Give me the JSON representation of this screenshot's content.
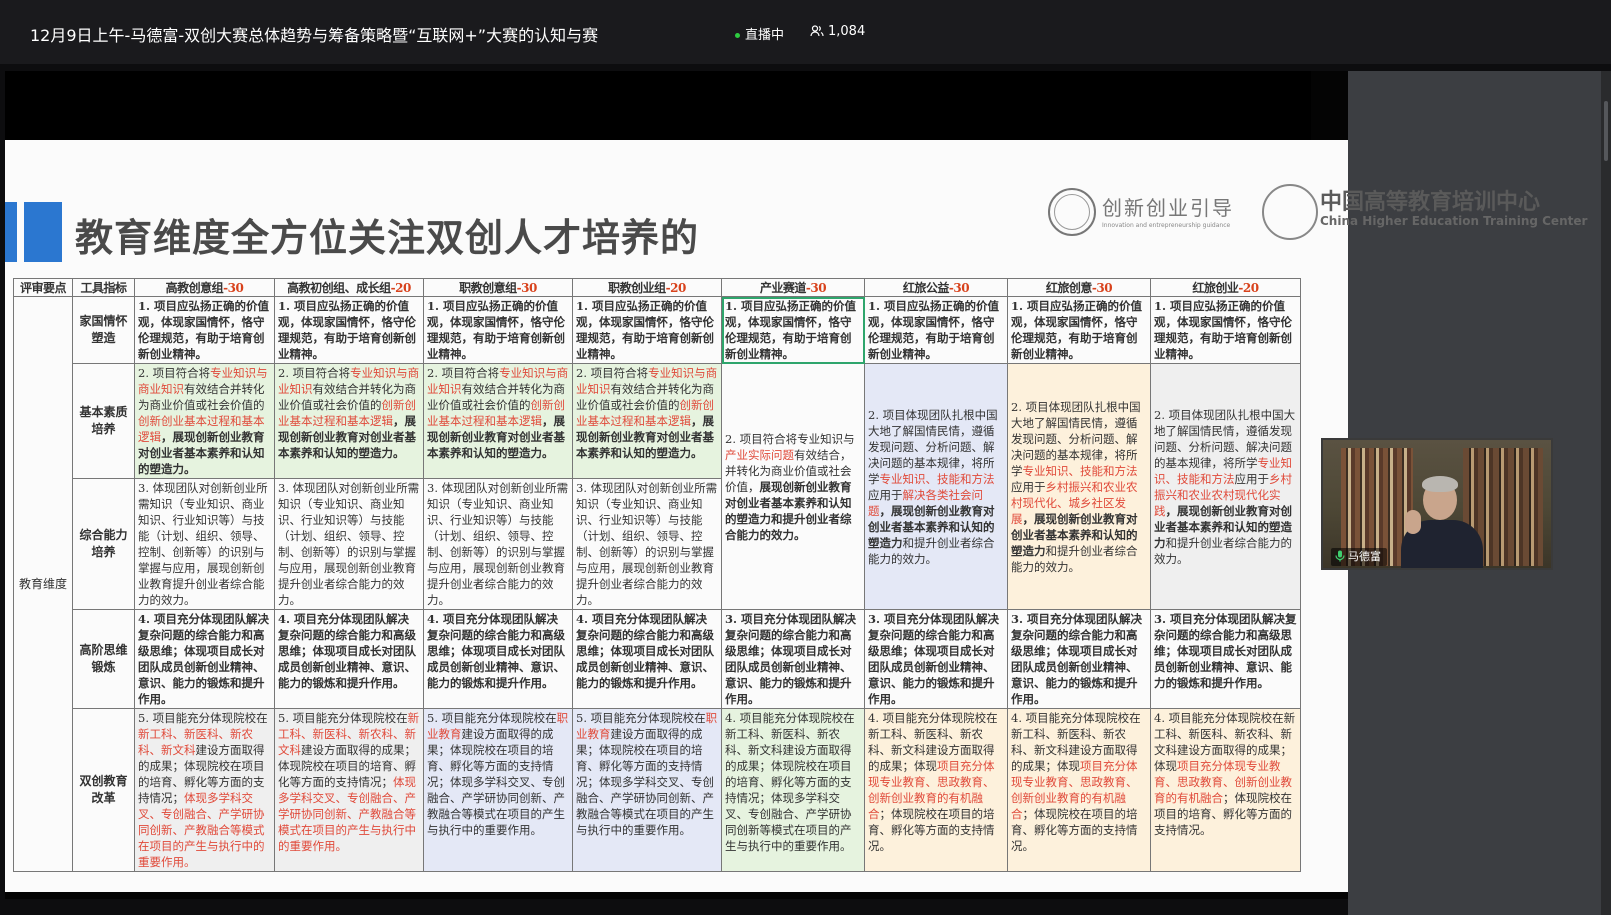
{
  "header": {
    "title": "12月9日上午-马德富-双创大赛总体趋势与筹备策略暨“互联网+”大赛的认知与赛",
    "live_label": "直播中",
    "viewer_count": "1,084"
  },
  "slide": {
    "title": "教育维度全方位关注双创人才培养的",
    "logo_text": "创新创业引导",
    "logo_subtext": "Innovation and entrepreneurship guidance",
    "org_name": "中国高等教育培训中心",
    "org_name_en": "China Higher Education Training Center"
  },
  "table": {
    "headers": [
      {
        "name": "评审要点",
        "score": ""
      },
      {
        "name": "工具指标",
        "score": ""
      },
      {
        "name": "高教创意组",
        "score": "-30"
      },
      {
        "name": "高教初创组、成长组",
        "score": "-20"
      },
      {
        "name": "职教创意组",
        "score": "-30"
      },
      {
        "name": "职教创业组",
        "score": "-20"
      },
      {
        "name": "产业赛道",
        "score": "-30"
      },
      {
        "name": "红旅公益",
        "score": "-30"
      },
      {
        "name": "红旅创意",
        "score": "-30"
      },
      {
        "name": "红旅创业",
        "score": "-20"
      }
    ],
    "dimension": "教育维度",
    "indicators": [
      "家国情怀塑造",
      "基本素质培养",
      "综合能力培养",
      "高阶思维锻炼",
      "双创教育改革"
    ],
    "row1": "1. 项目应弘扬正确的价值观，体现家国情怀，恪守伦理规范，有助于培育创新创业精神。",
    "row2a_1": "2. 项目符合将",
    "row2a_r1": "专业知识与商业知识",
    "row2a_2": "有效结合并转化为商业价值或社会价值的",
    "row2a_r2": "创新创业基本过程和基本逻辑",
    "row2a_3": "，展现创新创业教育对创业者基本素养和认知的塑造力。",
    "row2e_1": "2. 项目符合将专业知识与",
    "row2e_r": "产业实际问题",
    "row2e_2": "有效结合，并转化为商业价值或社会价值，",
    "row2e_b": "展现创新创业教育对创业者基本素养和认知的塑造力和提升创业者综合能力的效力。",
    "row2f_1": "2. 项目体现团队扎根中国大地了解国情民情，遵循发现问题、分析问题、解决问题的基本规律，将所学",
    "row2f_r1": "专业知识、技能和方法",
    "row2f_2": "应用于",
    "row2f_r2": "解决各类社会问题",
    "row2f_b": "，展现创新创业教育对创业者基本素养和认知的塑造力",
    "row2f_3": "和提升创业者综合能力的效力。",
    "row2g_r2": "乡村振兴和农业农村现代化、城乡社区发展",
    "row2g_b": "，展现创新创业教育对创业者基本素养和认知的塑造力",
    "row2g_3": "和提升创业者综合能力的效力。",
    "row2h_r2": "乡村振兴和农业农村现代化实践",
    "row2h_b": "，展现创新创业教育对创业者基本素养和认知的塑造力",
    "row2h_3": "和提升创业者综合能力的效力。",
    "row3": "3. 体现团队对创新创业所需知识（专业知识、商业知识、行业知识等）与技能（计划、组织、领导、控制、创新等）的识别与掌握与应用，展现创新创业教育提升创业者综合能力的效力。",
    "row4": "4. 项目充分体现团队解决复杂问题的综合能力和高级思维；体现项目成长对团队成员创新创业精神、意识、能力的锻炼和提升作用。",
    "row4e": "3. 项目充分体现团队解决复杂问题的综合能力和高级思维；体现项目成长对团队成员创新创业精神、意识、能力的锻炼和提升作用。",
    "row5a_1": "5. 项目能充分体现院校在",
    "row5a_r1": "新工科、新医科、新农科、新文科",
    "row5a_2": "建设方面取得的成果；体现院校在项目的培育、孵化等方面的支持情况；",
    "row5a_r2": "体现多学科交叉、专创融合、产学研协同创新、产教融合等模式在项目的产生与执行中的重要作用。",
    "row5c_1": "5. 项目能充分体现院校在",
    "row5c_r1": "职业教育",
    "row5c_2": "建设方面取得的成果；体现院校在项目的培育、孵化等方面的支持情况；体现多学科交叉、专创融合、产学研协同创新、产教融合等模式在项目的产生与执行中的重要作用。",
    "row5e": "4. 项目能充分体现院校在新工科、新医科、新农科、新文科建设方面取得的成果；体现院校在项目的培育、孵化等方面的支持情况；体现多学科交叉、专创融合、产学研协同创新等模式在项目的产生与执行中的重要作用。",
    "row5f_1": "4. 项目能充分体现院校在新工科、新医科、新农科、新文科建设方面取得的成果；体现",
    "row5f_r": "项目充分体现专业教育、思政教育、创新创业教育的有机融合",
    "row5f_2": "；体现院校在项目的培育、孵化等方面的支持情况。"
  },
  "presenter": {
    "name": "马德富"
  }
}
